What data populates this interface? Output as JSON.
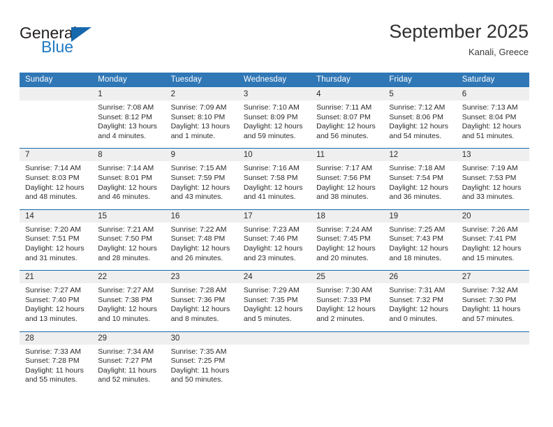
{
  "brand": {
    "name_top": "General",
    "name_bottom": "Blue",
    "triangle_icon": "triangle-icon",
    "accent_color": "#1668ad",
    "text_color": "#231f20"
  },
  "header": {
    "title": "September 2025",
    "location": "Kanali, Greece"
  },
  "colors": {
    "header_blue": "#3077b6",
    "divider_blue": "#1668ad",
    "daynum_band": "#efefef",
    "text": "#2b2b2b"
  },
  "calendar": {
    "weekday_headers": [
      "Sunday",
      "Monday",
      "Tuesday",
      "Wednesday",
      "Thursday",
      "Friday",
      "Saturday"
    ],
    "weeks": [
      [
        {
          "day": "",
          "lines": []
        },
        {
          "day": "1",
          "lines": [
            "Sunrise: 7:08 AM",
            "Sunset: 8:12 PM",
            "Daylight: 13 hours",
            "and 4 minutes."
          ]
        },
        {
          "day": "2",
          "lines": [
            "Sunrise: 7:09 AM",
            "Sunset: 8:10 PM",
            "Daylight: 13 hours",
            "and 1 minute."
          ]
        },
        {
          "day": "3",
          "lines": [
            "Sunrise: 7:10 AM",
            "Sunset: 8:09 PM",
            "Daylight: 12 hours",
            "and 59 minutes."
          ]
        },
        {
          "day": "4",
          "lines": [
            "Sunrise: 7:11 AM",
            "Sunset: 8:07 PM",
            "Daylight: 12 hours",
            "and 56 minutes."
          ]
        },
        {
          "day": "5",
          "lines": [
            "Sunrise: 7:12 AM",
            "Sunset: 8:06 PM",
            "Daylight: 12 hours",
            "and 54 minutes."
          ]
        },
        {
          "day": "6",
          "lines": [
            "Sunrise: 7:13 AM",
            "Sunset: 8:04 PM",
            "Daylight: 12 hours",
            "and 51 minutes."
          ]
        }
      ],
      [
        {
          "day": "7",
          "lines": [
            "Sunrise: 7:14 AM",
            "Sunset: 8:03 PM",
            "Daylight: 12 hours",
            "and 48 minutes."
          ]
        },
        {
          "day": "8",
          "lines": [
            "Sunrise: 7:14 AM",
            "Sunset: 8:01 PM",
            "Daylight: 12 hours",
            "and 46 minutes."
          ]
        },
        {
          "day": "9",
          "lines": [
            "Sunrise: 7:15 AM",
            "Sunset: 7:59 PM",
            "Daylight: 12 hours",
            "and 43 minutes."
          ]
        },
        {
          "day": "10",
          "lines": [
            "Sunrise: 7:16 AM",
            "Sunset: 7:58 PM",
            "Daylight: 12 hours",
            "and 41 minutes."
          ]
        },
        {
          "day": "11",
          "lines": [
            "Sunrise: 7:17 AM",
            "Sunset: 7:56 PM",
            "Daylight: 12 hours",
            "and 38 minutes."
          ]
        },
        {
          "day": "12",
          "lines": [
            "Sunrise: 7:18 AM",
            "Sunset: 7:54 PM",
            "Daylight: 12 hours",
            "and 36 minutes."
          ]
        },
        {
          "day": "13",
          "lines": [
            "Sunrise: 7:19 AM",
            "Sunset: 7:53 PM",
            "Daylight: 12 hours",
            "and 33 minutes."
          ]
        }
      ],
      [
        {
          "day": "14",
          "lines": [
            "Sunrise: 7:20 AM",
            "Sunset: 7:51 PM",
            "Daylight: 12 hours",
            "and 31 minutes."
          ]
        },
        {
          "day": "15",
          "lines": [
            "Sunrise: 7:21 AM",
            "Sunset: 7:50 PM",
            "Daylight: 12 hours",
            "and 28 minutes."
          ]
        },
        {
          "day": "16",
          "lines": [
            "Sunrise: 7:22 AM",
            "Sunset: 7:48 PM",
            "Daylight: 12 hours",
            "and 26 minutes."
          ]
        },
        {
          "day": "17",
          "lines": [
            "Sunrise: 7:23 AM",
            "Sunset: 7:46 PM",
            "Daylight: 12 hours",
            "and 23 minutes."
          ]
        },
        {
          "day": "18",
          "lines": [
            "Sunrise: 7:24 AM",
            "Sunset: 7:45 PM",
            "Daylight: 12 hours",
            "and 20 minutes."
          ]
        },
        {
          "day": "19",
          "lines": [
            "Sunrise: 7:25 AM",
            "Sunset: 7:43 PM",
            "Daylight: 12 hours",
            "and 18 minutes."
          ]
        },
        {
          "day": "20",
          "lines": [
            "Sunrise: 7:26 AM",
            "Sunset: 7:41 PM",
            "Daylight: 12 hours",
            "and 15 minutes."
          ]
        }
      ],
      [
        {
          "day": "21",
          "lines": [
            "Sunrise: 7:27 AM",
            "Sunset: 7:40 PM",
            "Daylight: 12 hours",
            "and 13 minutes."
          ]
        },
        {
          "day": "22",
          "lines": [
            "Sunrise: 7:27 AM",
            "Sunset: 7:38 PM",
            "Daylight: 12 hours",
            "and 10 minutes."
          ]
        },
        {
          "day": "23",
          "lines": [
            "Sunrise: 7:28 AM",
            "Sunset: 7:36 PM",
            "Daylight: 12 hours",
            "and 8 minutes."
          ]
        },
        {
          "day": "24",
          "lines": [
            "Sunrise: 7:29 AM",
            "Sunset: 7:35 PM",
            "Daylight: 12 hours",
            "and 5 minutes."
          ]
        },
        {
          "day": "25",
          "lines": [
            "Sunrise: 7:30 AM",
            "Sunset: 7:33 PM",
            "Daylight: 12 hours",
            "and 2 minutes."
          ]
        },
        {
          "day": "26",
          "lines": [
            "Sunrise: 7:31 AM",
            "Sunset: 7:32 PM",
            "Daylight: 12 hours",
            "and 0 minutes."
          ]
        },
        {
          "day": "27",
          "lines": [
            "Sunrise: 7:32 AM",
            "Sunset: 7:30 PM",
            "Daylight: 11 hours",
            "and 57 minutes."
          ]
        }
      ],
      [
        {
          "day": "28",
          "lines": [
            "Sunrise: 7:33 AM",
            "Sunset: 7:28 PM",
            "Daylight: 11 hours",
            "and 55 minutes."
          ]
        },
        {
          "day": "29",
          "lines": [
            "Sunrise: 7:34 AM",
            "Sunset: 7:27 PM",
            "Daylight: 11 hours",
            "and 52 minutes."
          ]
        },
        {
          "day": "30",
          "lines": [
            "Sunrise: 7:35 AM",
            "Sunset: 7:25 PM",
            "Daylight: 11 hours",
            "and 50 minutes."
          ]
        },
        {
          "day": "",
          "lines": []
        },
        {
          "day": "",
          "lines": []
        },
        {
          "day": "",
          "lines": []
        },
        {
          "day": "",
          "lines": []
        }
      ]
    ]
  }
}
